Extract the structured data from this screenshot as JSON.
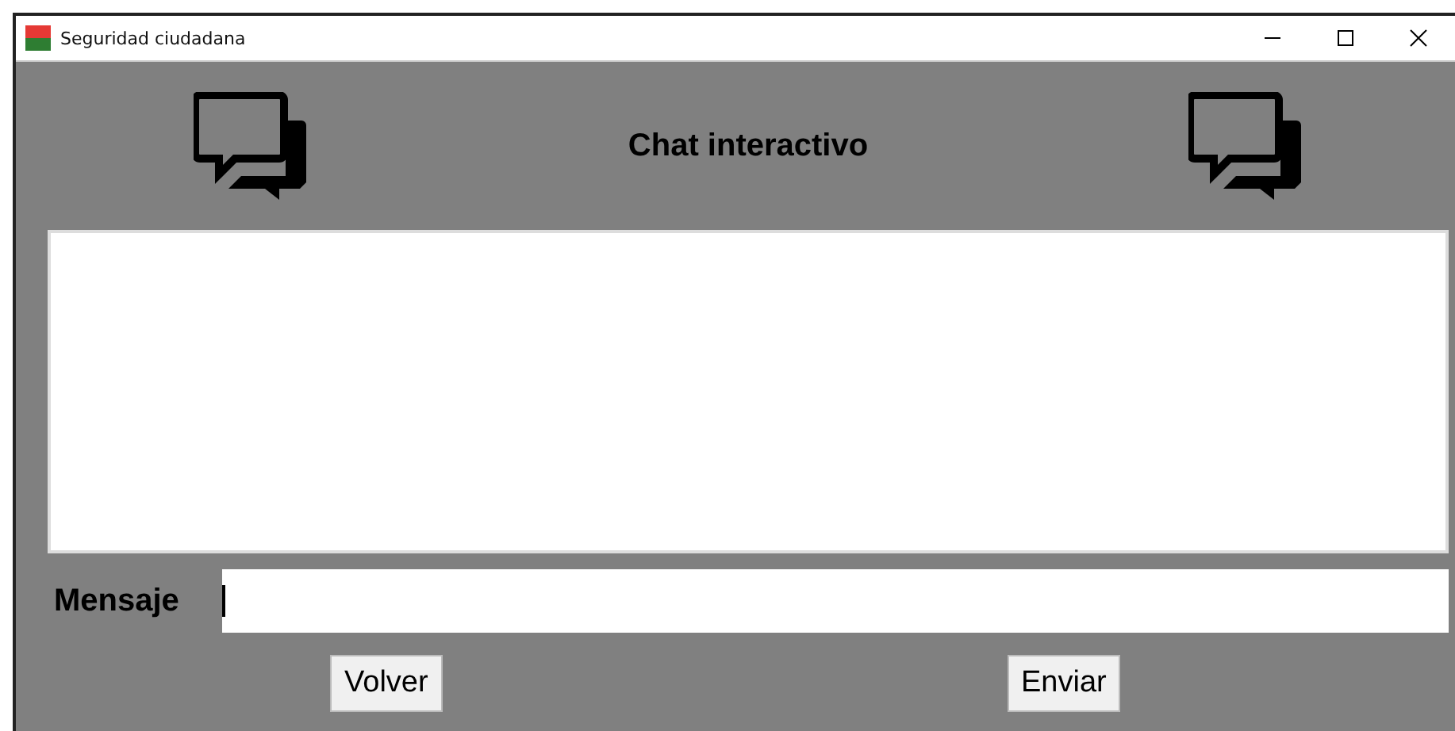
{
  "window": {
    "title": "Seguridad ciudadana"
  },
  "header": {
    "title": "Chat interactivo"
  },
  "message": {
    "label": "Mensaje"
  },
  "buttons": [
    {
      "label": "Volver"
    },
    {
      "label": "Enviar"
    }
  ]
}
